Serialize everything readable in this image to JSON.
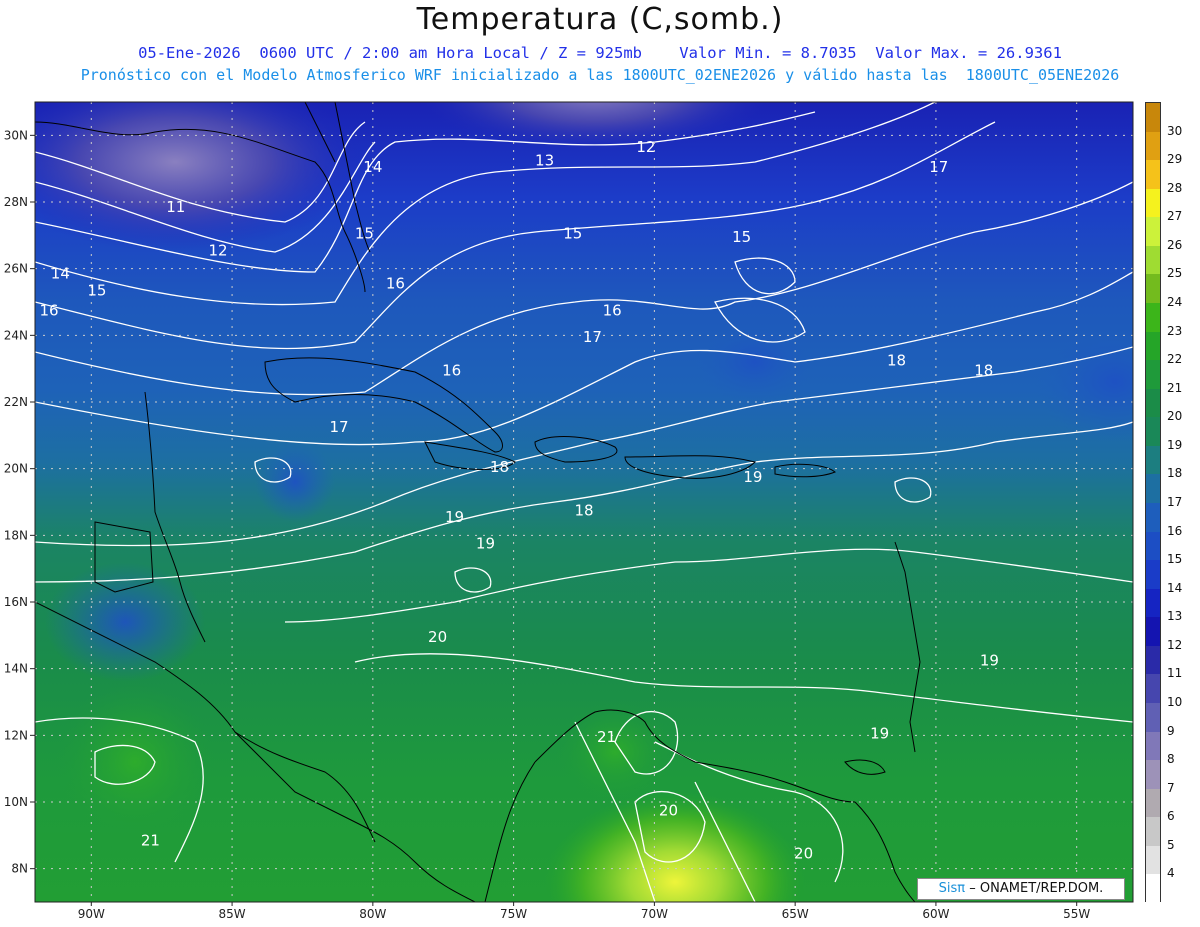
{
  "title": "Temperatura (C,somb.)",
  "subtitle_line1": "05-Ene-2026  0600 UTC / 2:00 am Hora Local / Z = 925mb    Valor Min. = 8.7035  Valor Max. = 26.9361",
  "subtitle_line2": "Pronóstico con el Modelo Atmosferico WRF inicializado a las 1800UTC_02ENE2026 y válido hasta las  1800UTC_05ENE2026",
  "credit": {
    "brand": "Sisπ",
    "text": "– ONAMET/REP.DOM."
  },
  "map": {
    "lon_range": [
      -92,
      -53
    ],
    "lat_range": [
      7,
      31
    ],
    "lat_ticks": [
      {
        "value": 30,
        "label": "30N"
      },
      {
        "value": 28,
        "label": "28N"
      },
      {
        "value": 26,
        "label": "26N"
      },
      {
        "value": 24,
        "label": "24N"
      },
      {
        "value": 22,
        "label": "22N"
      },
      {
        "value": 20,
        "label": "20N"
      },
      {
        "value": 18,
        "label": "18N"
      },
      {
        "value": 16,
        "label": "16N"
      },
      {
        "value": 14,
        "label": "14N"
      },
      {
        "value": 12,
        "label": "12N"
      },
      {
        "value": 10,
        "label": "10N"
      },
      {
        "value": 8,
        "label": "8N"
      }
    ],
    "lon_ticks": [
      {
        "value": -90,
        "label": "90W"
      },
      {
        "value": -85,
        "label": "85W"
      },
      {
        "value": -80,
        "label": "80W"
      },
      {
        "value": -75,
        "label": "75W"
      },
      {
        "value": -70,
        "label": "70W"
      },
      {
        "value": -65,
        "label": "65W"
      },
      {
        "value": -60,
        "label": "60W"
      },
      {
        "value": -55,
        "label": "55W"
      }
    ],
    "contour_labels": [
      {
        "text": "12",
        "lon": -70.3,
        "lat": 29.5
      },
      {
        "text": "13",
        "lon": -73.9,
        "lat": 29.1
      },
      {
        "text": "14",
        "lon": -80.0,
        "lat": 28.9
      },
      {
        "text": "11",
        "lon": -87.0,
        "lat": 27.7
      },
      {
        "text": "12",
        "lon": -85.5,
        "lat": 26.4
      },
      {
        "text": "15",
        "lon": -80.3,
        "lat": 26.9
      },
      {
        "text": "15",
        "lon": -72.9,
        "lat": 26.9
      },
      {
        "text": "15",
        "lon": -66.9,
        "lat": 26.8
      },
      {
        "text": "17",
        "lon": -59.9,
        "lat": 28.9
      },
      {
        "text": "14",
        "lon": -91.1,
        "lat": 25.7
      },
      {
        "text": "15",
        "lon": -89.8,
        "lat": 25.2
      },
      {
        "text": "16",
        "lon": -91.5,
        "lat": 24.6
      },
      {
        "text": "16",
        "lon": -79.2,
        "lat": 25.4
      },
      {
        "text": "16",
        "lon": -71.5,
        "lat": 24.6
      },
      {
        "text": "17",
        "lon": -72.2,
        "lat": 23.8
      },
      {
        "text": "16",
        "lon": -77.2,
        "lat": 22.8
      },
      {
        "text": "18",
        "lon": -61.4,
        "lat": 23.1
      },
      {
        "text": "18",
        "lon": -58.3,
        "lat": 22.8
      },
      {
        "text": "17",
        "lon": -81.2,
        "lat": 21.1
      },
      {
        "text": "18",
        "lon": -75.5,
        "lat": 19.9
      },
      {
        "text": "19",
        "lon": -66.5,
        "lat": 19.6
      },
      {
        "text": "18",
        "lon": -72.5,
        "lat": 18.6
      },
      {
        "text": "19",
        "lon": -77.1,
        "lat": 18.4
      },
      {
        "text": "19",
        "lon": -76.0,
        "lat": 17.6
      },
      {
        "text": "20",
        "lon": -77.7,
        "lat": 14.8
      },
      {
        "text": "19",
        "lon": -58.1,
        "lat": 14.1
      },
      {
        "text": "19",
        "lon": -62.0,
        "lat": 11.9
      },
      {
        "text": "21",
        "lon": -71.7,
        "lat": 11.8
      },
      {
        "text": "20",
        "lon": -69.5,
        "lat": 9.6
      },
      {
        "text": "20",
        "lon": -64.7,
        "lat": 8.3
      },
      {
        "text": "21",
        "lon": -87.9,
        "lat": 8.7
      }
    ]
  },
  "colorbar": {
    "levels": [
      {
        "label": "30",
        "color": "#c8870b"
      },
      {
        "label": "29",
        "color": "#e0a012"
      },
      {
        "label": "28",
        "color": "#f5c21a"
      },
      {
        "label": "27",
        "color": "#f5f21e"
      },
      {
        "label": "26",
        "color": "#ccf23a"
      },
      {
        "label": "25",
        "color": "#9fdc32"
      },
      {
        "label": "24",
        "color": "#73bb1e"
      },
      {
        "label": "23",
        "color": "#3cb51a"
      },
      {
        "label": "22",
        "color": "#25a528"
      },
      {
        "label": "21",
        "color": "#1f9a3a"
      },
      {
        "label": "20",
        "color": "#1b8c48"
      },
      {
        "label": "19",
        "color": "#1a8858"
      },
      {
        "label": "18",
        "color": "#1c7e80"
      },
      {
        "label": "17",
        "color": "#1d6fa2"
      },
      {
        "label": "16",
        "color": "#1e5ebc"
      },
      {
        "label": "15",
        "color": "#1c4ec4"
      },
      {
        "label": "14",
        "color": "#1a3cc8"
      },
      {
        "label": "13",
        "color": "#1524c2"
      },
      {
        "label": "12",
        "color": "#1414b0"
      },
      {
        "label": "11",
        "color": "#2a2aa8"
      },
      {
        "label": "10",
        "color": "#4646ae"
      },
      {
        "label": "9",
        "color": "#6060b4"
      },
      {
        "label": "8",
        "color": "#8078b8"
      },
      {
        "label": "7",
        "color": "#9d92b8"
      },
      {
        "label": "6",
        "color": "#b0aab0"
      },
      {
        "label": "5",
        "color": "#c8c8c8"
      },
      {
        "label": "4",
        "color": "#e2e2e2"
      },
      {
        "label": "",
        "color": "#ffffff"
      }
    ]
  }
}
